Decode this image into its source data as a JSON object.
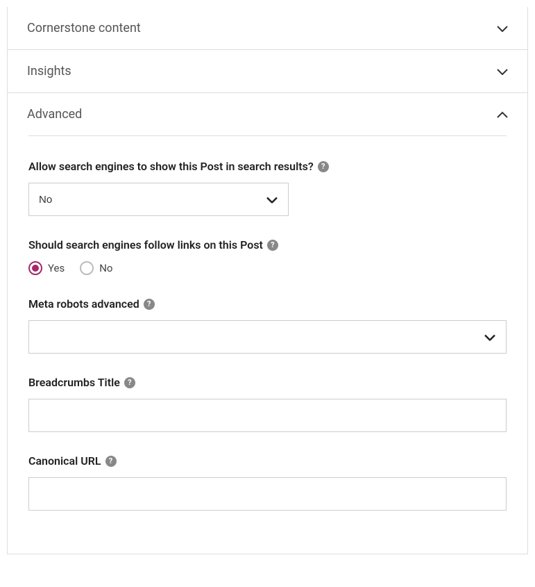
{
  "panels": {
    "cornerstone": {
      "title": "Cornerstone content"
    },
    "insights": {
      "title": "Insights"
    },
    "advanced": {
      "title": "Advanced"
    }
  },
  "fields": {
    "allowSearch": {
      "label": "Allow search engines to show this Post in search results?",
      "value": "No"
    },
    "followLinks": {
      "label": "Should search engines follow links on this Post",
      "options": {
        "yes": "Yes",
        "no": "No"
      },
      "selected": "yes"
    },
    "metaRobots": {
      "label": "Meta robots advanced",
      "value": ""
    },
    "breadcrumbs": {
      "label": "Breadcrumbs Title",
      "value": ""
    },
    "canonical": {
      "label": "Canonical URL",
      "value": ""
    }
  }
}
